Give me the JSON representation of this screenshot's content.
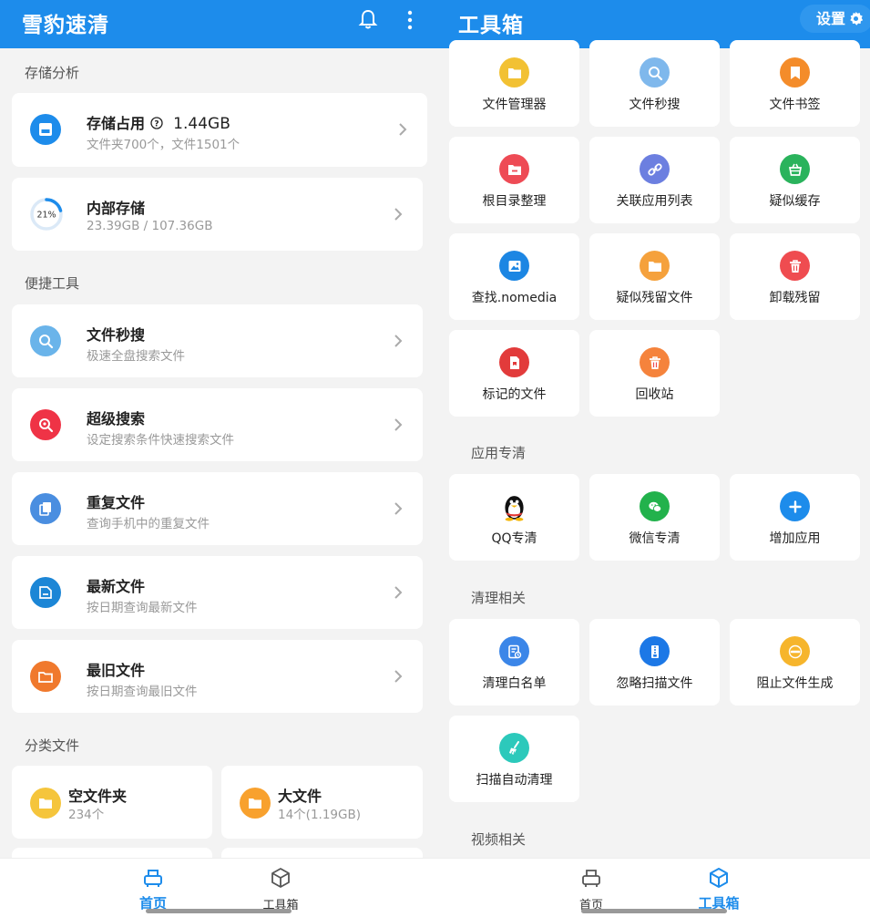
{
  "colors": {
    "accent": "#1d8ceb",
    "bg": "#f3f3f3"
  },
  "left": {
    "title": "雪豹速清",
    "sections": {
      "storage": "存储分析",
      "tools": "便捷工具",
      "category": "分类文件"
    },
    "storage_usage": {
      "title": "存储占用",
      "value": "1.44GB",
      "sub": "文件夹700个，文件1501个"
    },
    "internal": {
      "title": "内部存储",
      "sub": "23.39GB / 107.36GB",
      "percent_label": "21%",
      "percent": 21
    },
    "tools": [
      {
        "title": "文件秒搜",
        "sub": "极速全盘搜索文件",
        "icon": "search-icon",
        "color": "#6ab4ea"
      },
      {
        "title": "超级搜索",
        "sub": "设定搜索条件快速搜索文件",
        "icon": "super-search-icon",
        "color": "#ef3346"
      },
      {
        "title": "重复文件",
        "sub": "查询手机中的重复文件",
        "icon": "duplicate-file-icon",
        "color": "#4a8ee0"
      },
      {
        "title": "最新文件",
        "sub": "按日期查询最新文件",
        "icon": "newest-file-icon",
        "color": "#1c86d6"
      },
      {
        "title": "最旧文件",
        "sub": "按日期查询最旧文件",
        "icon": "oldest-file-icon",
        "color": "#f0792d"
      }
    ],
    "categories": [
      {
        "title": "空文件夹",
        "sub": "234个",
        "icon": "folder-icon",
        "color": "#f5c53c"
      },
      {
        "title": "大文件",
        "sub": "14个(1.19GB)",
        "icon": "folder-icon",
        "color": "#f8a12e"
      }
    ],
    "nav": {
      "home": "首页",
      "toolbox": "工具箱"
    }
  },
  "right": {
    "title": "工具箱",
    "settings": "设置",
    "tools": [
      {
        "label": "文件管理器",
        "icon": "folder-icon",
        "color": "#f2c133"
      },
      {
        "label": "文件秒搜",
        "icon": "search-icon",
        "color": "#7fb8ec"
      },
      {
        "label": "文件书签",
        "icon": "bookmark-icon",
        "color": "#f48c2a"
      },
      {
        "label": "根目录整理",
        "icon": "folder-minus-icon",
        "color": "#ee4b55"
      },
      {
        "label": "关联应用列表",
        "icon": "link-icon",
        "color": "#6c7fe0"
      },
      {
        "label": "疑似缓存",
        "icon": "basket-icon",
        "color": "#2ab35c"
      },
      {
        "label": "查找.nomedia",
        "icon": "image-icon",
        "color": "#1c86e3"
      },
      {
        "label": "疑似残留文件",
        "icon": "folder-icon",
        "color": "#f5a13c"
      },
      {
        "label": "卸载残留",
        "icon": "trash-icon",
        "color": "#ef4c50"
      },
      {
        "label": "标记的文件",
        "icon": "marked-file-icon",
        "color": "#e23b3b"
      },
      {
        "label": "回收站",
        "icon": "trash-icon",
        "color": "#f5833c"
      }
    ],
    "app_section": "应用专清",
    "apps": [
      {
        "label": "QQ专清",
        "icon": "qq-penguin-icon",
        "color": "#111111"
      },
      {
        "label": "微信专清",
        "icon": "wechat-icon",
        "color": "#22b24c"
      },
      {
        "label": "增加应用",
        "icon": "plus-icon",
        "color": "#1d8ceb"
      }
    ],
    "clean_section": "清理相关",
    "clean": [
      {
        "label": "清理白名单",
        "icon": "whitelist-icon",
        "color": "#3b86e8"
      },
      {
        "label": "忽略扫描文件",
        "icon": "ignore-scan-icon",
        "color": "#1c78e6"
      },
      {
        "label": "阻止文件生成",
        "icon": "block-icon",
        "color": "#f6b52c"
      },
      {
        "label": "扫描自动清理",
        "icon": "broom-icon",
        "color": "#2cc9bb"
      }
    ],
    "video_section": "视频相关",
    "nav": {
      "home": "首页",
      "toolbox": "工具箱"
    }
  }
}
